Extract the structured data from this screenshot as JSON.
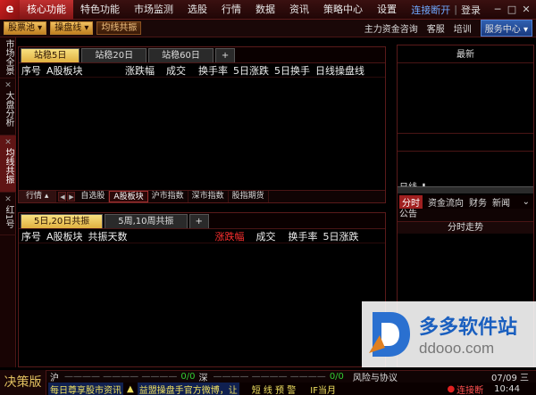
{
  "topbar": {
    "menu": [
      "核心功能",
      "特色功能",
      "市场监测",
      "选股",
      "行情",
      "数据",
      "资讯",
      "策略中心",
      "设置"
    ],
    "status": "连接断开",
    "login": "登录"
  },
  "toolbar2": {
    "left_buttons": [
      "股票池",
      "操盘线",
      "均线共振"
    ],
    "right_items": [
      "主力资金咨询",
      "客服",
      "培训"
    ],
    "service": "服务中心"
  },
  "vtabs": [
    {
      "label": "市场全景",
      "active": false
    },
    {
      "label": "大盘分析",
      "active": false
    },
    {
      "label": "均线共振",
      "active": true
    },
    {
      "label": "红1号",
      "active": false
    }
  ],
  "top_panel": {
    "tabs": [
      "站稳5日",
      "站稳20日",
      "站稳60日",
      "+"
    ],
    "columns": [
      "序号",
      "A股板块",
      "涨跌幅",
      "成交",
      "换手率",
      "5日涨跌",
      "5日换手",
      "日线操盘线"
    ],
    "bottom_tabs": [
      "行情",
      "自选股",
      "A股板块",
      "沪市指数",
      "深市指数",
      "股指期货"
    ]
  },
  "bottom_panel": {
    "tabs": [
      "5日,20日共振",
      "5周,10周共振",
      "+"
    ],
    "columns": [
      "序号",
      "A股板块",
      "共振天数",
      "涨跌幅",
      "成交",
      "换手率",
      "5日涨跌"
    ]
  },
  "right_panel": {
    "title": "最新",
    "kline_label": "日线",
    "tabs": [
      "分时",
      "资金流向",
      "财务",
      "新闻"
    ],
    "announce": "公告",
    "trend": "分时走势"
  },
  "statusbar": {
    "edition": "决策版",
    "sh_label": "沪",
    "sh_count": "0/0",
    "sz_label": "深",
    "sz_count": "0/0",
    "risk": "风险与协议",
    "date": "07/09 三",
    "ticker1": "每日尊享股市资讯",
    "ticker2": "益盟操盘手官方微博，让",
    "alert": "短 线 预 警",
    "ifmonth": "IF当月",
    "conn": "连接断",
    "time": "10:44"
  },
  "watermark": {
    "name": "多多软件站",
    "url": "ddooo.com"
  }
}
